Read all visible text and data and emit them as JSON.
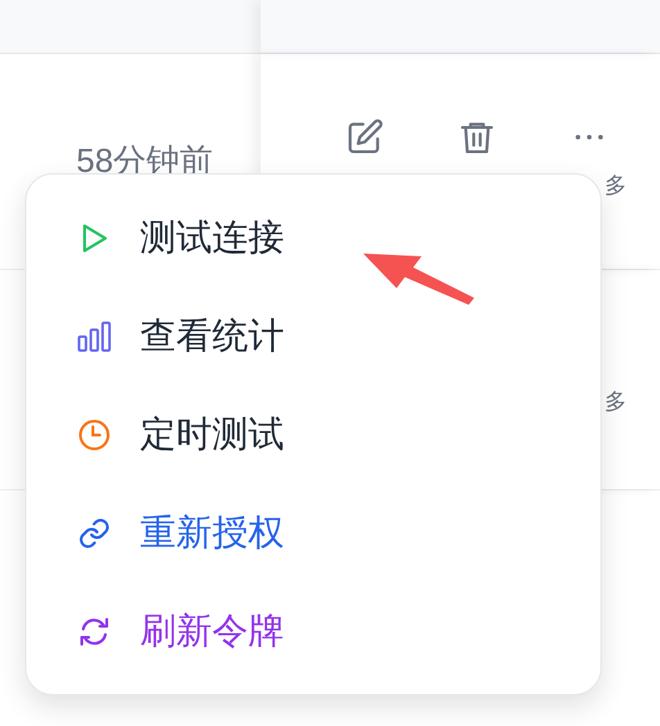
{
  "table": {
    "rows": [
      {
        "time": "58分钟前",
        "action_labels": [
          "多"
        ]
      },
      {
        "action_labels": [
          "多"
        ]
      }
    ]
  },
  "menu": {
    "items": [
      {
        "label": "测试连接",
        "color": "#22c55e",
        "colored_label": false
      },
      {
        "label": "查看统计",
        "color": "#6366f1",
        "colored_label": false
      },
      {
        "label": "定时测试",
        "color": "#f97316",
        "colored_label": false
      },
      {
        "label": "重新授权",
        "color": "#2563eb",
        "colored_label": true
      },
      {
        "label": "刷新令牌",
        "color": "#9333ea",
        "colored_label": true
      }
    ]
  }
}
